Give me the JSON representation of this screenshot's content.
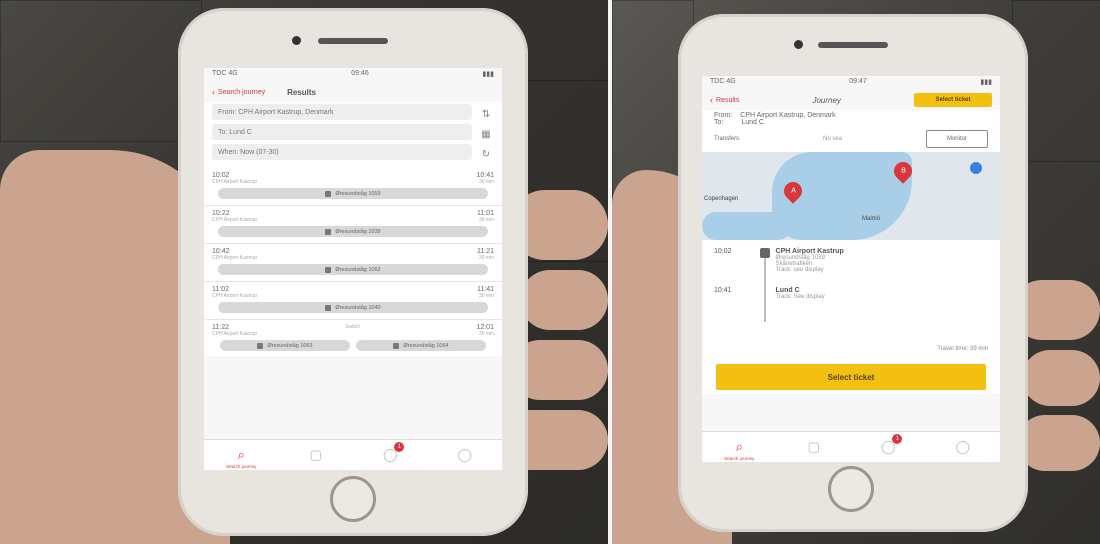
{
  "results_screen": {
    "status": {
      "carrier": "TDC 4G",
      "time": "09:46",
      "battery": "▮▮▮"
    },
    "nav": {
      "back_label": "Search journey",
      "title": "Results"
    },
    "search": {
      "from_field": "From: CPH Airport Kastrup, Denmark",
      "to_field": "To: Lund C",
      "when_field": "When: Now (07-30)"
    },
    "side_icons": {
      "swap": "⇅",
      "calendar": "▦",
      "refresh": "↻"
    },
    "rows": [
      {
        "depart": "10:02",
        "arrive": "10:41",
        "from": "CPH Airport Kastrup",
        "duration": "39 min",
        "train": "Øresundståg 1059"
      },
      {
        "depart": "10:22",
        "arrive": "11:01",
        "from": "CPH Airport Kastrup",
        "duration": "39 min",
        "train": "Øresundståg 1039"
      },
      {
        "depart": "10:42",
        "arrive": "11:21",
        "from": "CPH Airport Kastrup",
        "duration": "39 min",
        "train": "Øresundståg 1062"
      },
      {
        "depart": "11:02",
        "arrive": "11:41",
        "from": "CPH Airport Kastrup",
        "duration": "39 min",
        "train": "Øresundståg 1040"
      },
      {
        "depart": "11:22",
        "arrive": "12:01",
        "from": "CPH Airport Kastrup",
        "duration": "39 min",
        "train": "Øresundståg 1063"
      }
    ],
    "last_pill_right": "Øresundståg 1064",
    "mid_label": "Switch",
    "tabs": [
      {
        "icon": "search-icon",
        "glyph": "⌕",
        "label": "Search journey",
        "active": true
      },
      {
        "icon": "ticket-icon",
        "glyph": "▢",
        "label": "",
        "active": false
      },
      {
        "icon": "cart-icon",
        "glyph": "◯",
        "label": "",
        "active": false,
        "badge": "1"
      },
      {
        "icon": "chat-icon",
        "glyph": "◯",
        "label": "",
        "active": false
      }
    ]
  },
  "journey_screen": {
    "status": {
      "carrier": "TDC 4G",
      "time": "09:47",
      "battery": "▮▮▮"
    },
    "nav": {
      "back_label": "Results",
      "title": "Journey",
      "action": "Select ticket"
    },
    "from_label": "From:",
    "from_value": "CPH Airport Kastrup, Denmark",
    "to_label": "To:",
    "to_value": "Lund C",
    "transfers_label": "Transfers",
    "transfers_value": "No sea",
    "monitor_button": "Monitor",
    "map_labels": {
      "city": "Copenhagen",
      "area": "Malmö",
      "pin_a": "A",
      "pin_b": "B"
    },
    "legs": {
      "depart_time": "10:02",
      "depart_station": "CPH Airport Kastrup",
      "depart_detail1": "Øresundståg 1059",
      "depart_detail2": "Skånetrafiken",
      "depart_track": "Track: see display",
      "arrive_time": "10:41",
      "arrive_station": "Lund C",
      "arrive_track": "Track: See display",
      "travel_time": "Travel time: 39 min"
    },
    "select_ticket_button": "Select ticket",
    "tabs": [
      {
        "icon": "search-icon",
        "glyph": "⌕",
        "label": "Search journey",
        "active": true
      },
      {
        "icon": "ticket-icon",
        "glyph": "▢",
        "label": "",
        "active": false
      },
      {
        "icon": "cart-icon",
        "glyph": "◯",
        "label": "",
        "active": false,
        "badge": "1"
      },
      {
        "icon": "chat-icon",
        "glyph": "◯",
        "label": "",
        "active": false
      }
    ]
  },
  "colors": {
    "accent_red": "#d9363e",
    "accent_yellow": "#f2c011"
  }
}
